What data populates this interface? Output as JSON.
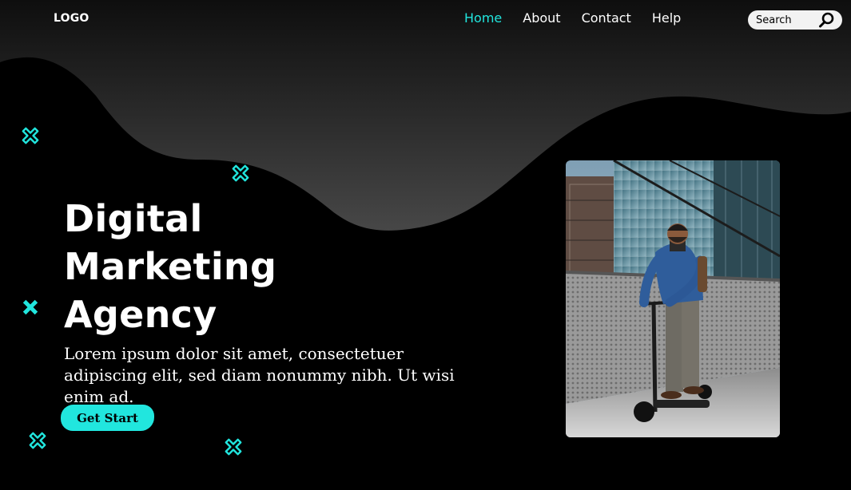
{
  "header": {
    "logo": "LOGO",
    "nav": [
      {
        "label": "Home",
        "active": true
      },
      {
        "label": "About",
        "active": false
      },
      {
        "label": "Contact",
        "active": false
      },
      {
        "label": "Help",
        "active": false
      }
    ],
    "search": {
      "placeholder": "Search",
      "icon": "search-icon"
    }
  },
  "hero": {
    "title_lines": [
      "Digital",
      "Marketing",
      "Agency"
    ],
    "description": "Lorem ipsum dolor sit amet, consectetuer adipiscing elit, sed diam nonummy nibh. Ut wisi enim ad.",
    "cta_label": "Get Start"
  },
  "colors": {
    "accent": "#21e6de",
    "background": "#000000",
    "wave_top": "#0f0f0f",
    "wave_bottom": "#434343"
  }
}
